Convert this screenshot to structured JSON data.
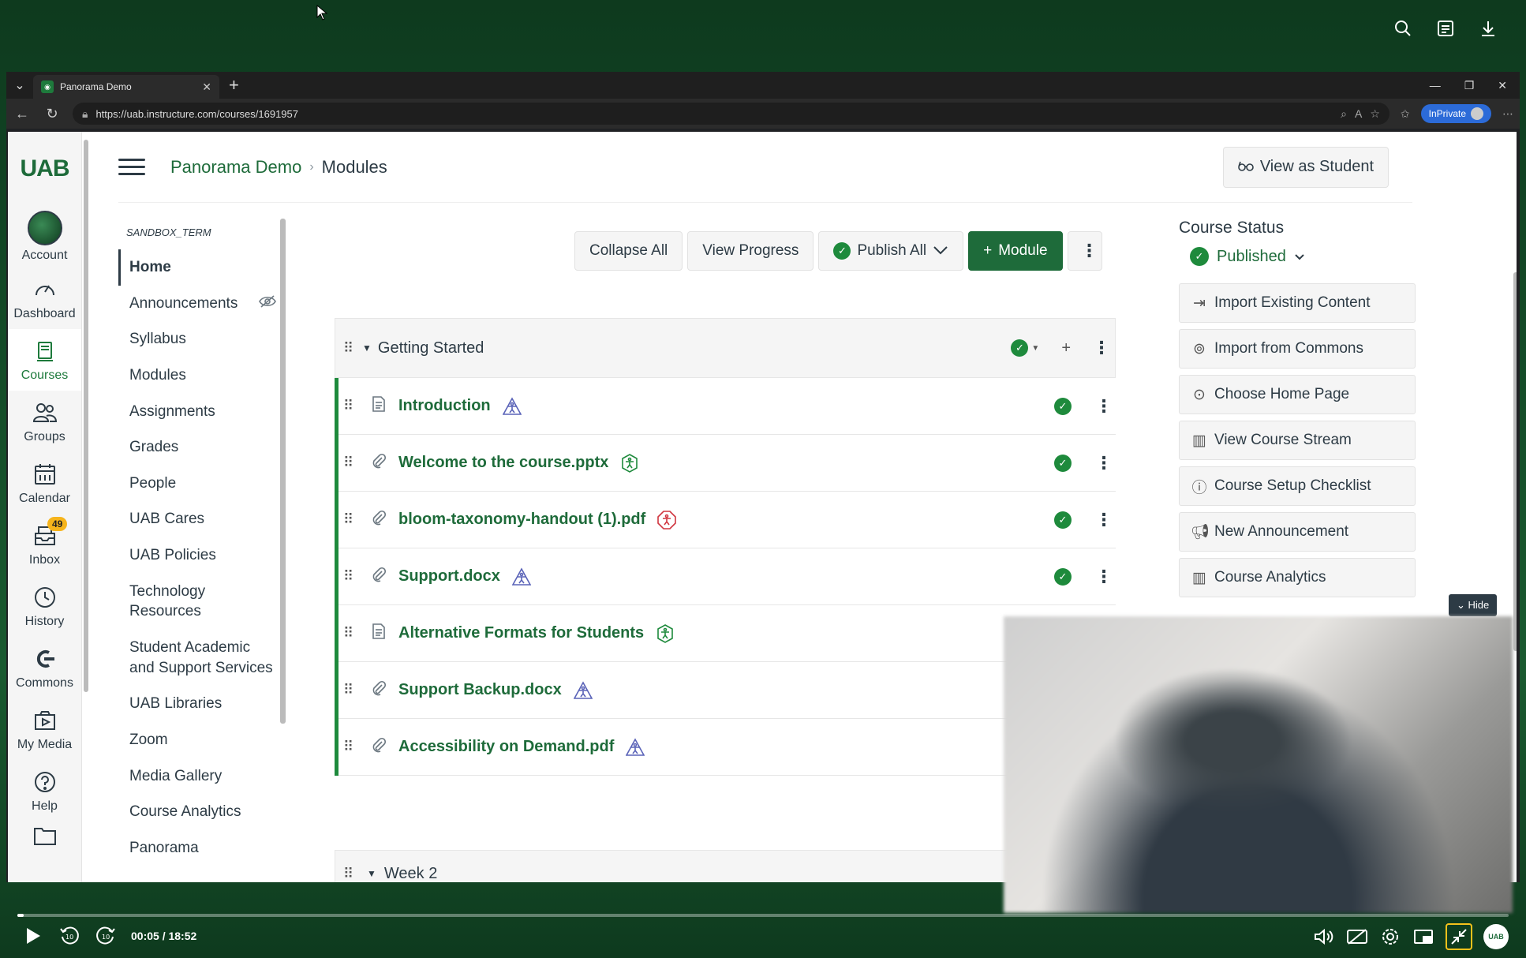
{
  "browser": {
    "tab_title": "Panorama Demo",
    "url": "https://uab.instructure.com/courses/1691957",
    "inprivate_label": "InPrivate"
  },
  "global_nav": {
    "logo": "UAB",
    "items": [
      {
        "label": "Account",
        "icon": "account-avatar"
      },
      {
        "label": "Dashboard",
        "icon": "gauge-icon"
      },
      {
        "label": "Courses",
        "icon": "book-icon"
      },
      {
        "label": "Groups",
        "icon": "groups-icon"
      },
      {
        "label": "Calendar",
        "icon": "calendar-icon"
      },
      {
        "label": "Inbox",
        "icon": "inbox-icon",
        "badge": "49"
      },
      {
        "label": "History",
        "icon": "clock-icon"
      },
      {
        "label": "Commons",
        "icon": "commons-icon"
      },
      {
        "label": "My Media",
        "icon": "media-icon"
      },
      {
        "label": "Help",
        "icon": "help-icon"
      }
    ]
  },
  "header": {
    "course": "Panorama Demo",
    "page": "Modules",
    "view_as_student": "View as Student"
  },
  "course_nav": {
    "term": "SANDBOX_TERM",
    "items": [
      "Home",
      "Announcements",
      "Syllabus",
      "Modules",
      "Assignments",
      "Grades",
      "People",
      "UAB Cares",
      "UAB Policies",
      "Technology Resources",
      "Student Academic and Support Services",
      "UAB Libraries",
      "Zoom",
      "Media Gallery",
      "Course Analytics",
      "Panorama"
    ]
  },
  "toolbar": {
    "collapse_all": "Collapse All",
    "view_progress": "View Progress",
    "publish_all": "Publish All",
    "add_module": "Module"
  },
  "module": {
    "title": "Getting Started",
    "items": [
      {
        "title": "Introduction",
        "type": "page",
        "a11y": "blue",
        "published": true
      },
      {
        "title": "Welcome to the course.pptx",
        "type": "attachment",
        "a11y": "green",
        "published": true
      },
      {
        "title": "bloom-taxonomy-handout (1).pdf",
        "type": "attachment",
        "a11y": "red",
        "published": true
      },
      {
        "title": "Support.docx",
        "type": "attachment",
        "a11y": "blue",
        "published": true
      },
      {
        "title": "Alternative Formats for Students",
        "type": "page",
        "a11y": "green",
        "published": false
      },
      {
        "title": "Support Backup.docx",
        "type": "attachment",
        "a11y": "blue",
        "published": false
      },
      {
        "title": "Accessibility on Demand.pdf",
        "type": "attachment",
        "a11y": "blue",
        "published": false
      }
    ],
    "next_title": "Week 2"
  },
  "course_status": {
    "heading": "Course Status",
    "status": "Published",
    "buttons": [
      {
        "label": "Import Existing Content",
        "icon": "import-icon"
      },
      {
        "label": "Import from Commons",
        "icon": "commons-icon"
      },
      {
        "label": "Choose Home Page",
        "icon": "target-icon"
      },
      {
        "label": "View Course Stream",
        "icon": "bar-chart-icon"
      },
      {
        "label": "Course Setup Checklist",
        "icon": "question-icon"
      },
      {
        "label": "New Announcement",
        "icon": "megaphone-icon"
      },
      {
        "label": "Course Analytics",
        "icon": "bar-chart-icon"
      }
    ]
  },
  "video": {
    "hide_label": "Hide",
    "time": "00:05 / 18:52",
    "progress_fraction": 0.0044,
    "brand_mark": "UAB"
  },
  "colors": {
    "brand_green": "#1e6b3a",
    "published_green": "#1e8a3c",
    "a11y_blue": "#5a63b8",
    "a11y_red": "#d0353f"
  }
}
